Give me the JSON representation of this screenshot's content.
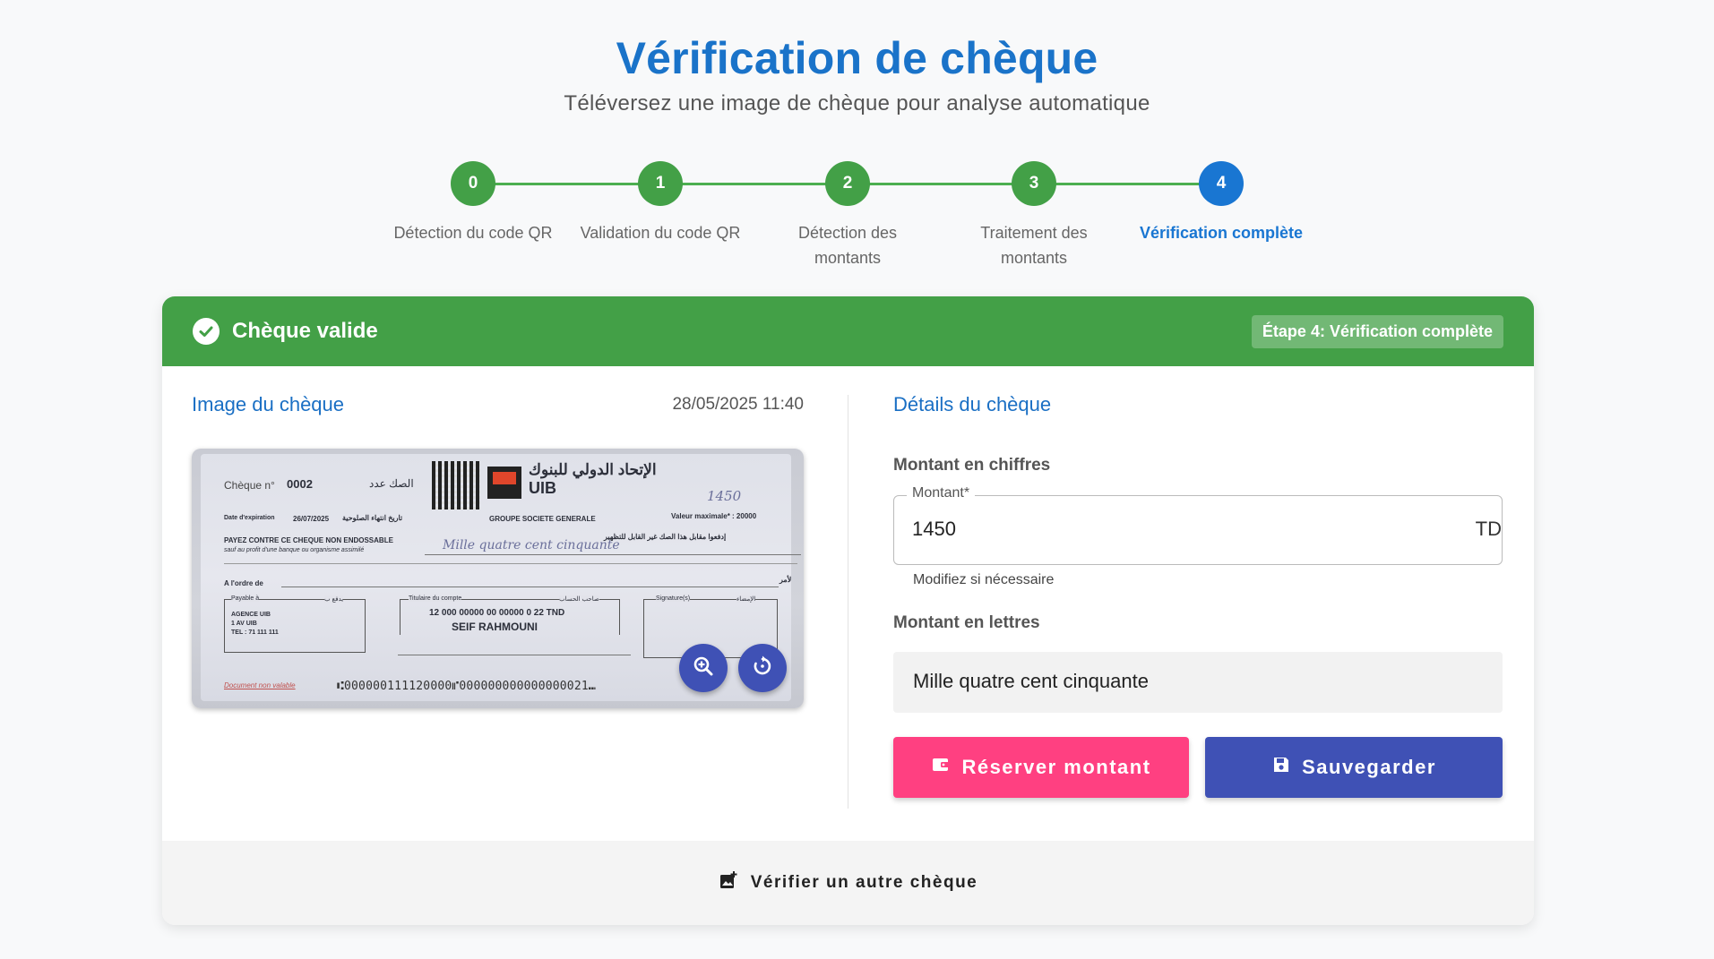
{
  "header": {
    "title": "Vérification de chèque",
    "subtitle": "Téléversez une image de chèque pour analyse automatique"
  },
  "stepper": {
    "steps": [
      {
        "number": "0",
        "label": "Détection du code QR",
        "status": "done"
      },
      {
        "number": "1",
        "label": "Validation du code QR",
        "status": "done"
      },
      {
        "number": "2",
        "label": "Détection des montants",
        "status": "done"
      },
      {
        "number": "3",
        "label": "Traitement des montants",
        "status": "done"
      },
      {
        "number": "4",
        "label": "Vérification complète",
        "status": "active"
      }
    ]
  },
  "result": {
    "status_title": "Chèque valide",
    "step_badge": "Étape 4: Vérification complète"
  },
  "image_section": {
    "title": "Image du chèque",
    "timestamp": "28/05/2025 11:40",
    "cheque": {
      "cheque_no_label": "Chèque n°",
      "cheque_no": "0002",
      "cheque_no_ar": "الصك عدد",
      "bank_ar": "الإتحاد الدولي للبنوك",
      "bank": "UIB",
      "group": "GROUPE SOCIETE GENERALE",
      "expiry_label": "Date d'expiration",
      "expiry": "26/07/2025",
      "expiry_ar": "تاريخ انتهاء الصلوحية",
      "max_value": "Valeur maximale* : 20000",
      "handwritten_amount": "1450",
      "pay_text": "PAYEZ CONTRE CE CHEQUE NON ENDOSSABLE",
      "pay_sub": "sauf au profit d'une banque ou organisme assimilé",
      "pay_ar": "إدفعوا مقابل هذا الصك غير القابل للتظهير",
      "handwritten_words": "Mille quatre cent cinquante",
      "order_label": "A l'ordre de",
      "order_ar": "لأمر",
      "payable_label": "Payable à",
      "payable_ar": "يدفع ب",
      "agency_lines": [
        "AGENCE UIB",
        "1 AV UIB",
        "TEL : 71 111 111"
      ],
      "holder_label": "Titulaire du compte",
      "holder_ar": "صاحب الحساب",
      "account": "12 000 00000 00 00000 0 22 TND",
      "holder_name": "SEIF RAHMOUNI",
      "signature_label": "Signature(s)",
      "signature_ar": "الإمضاء",
      "watermark": "Document non valable",
      "micr": "⑆000000111120000⑈000000000000000021⑉"
    },
    "zoom_icon": "zoom-in-icon",
    "rotate_icon": "rotate-icon"
  },
  "details": {
    "title": "Détails du chèque",
    "amount_digits_label": "Montant en chiffres",
    "amount_field_legend": "Montant*",
    "amount_value": "1450",
    "currency_suffix": "TD",
    "amount_helper": "Modifiez si nécessaire",
    "amount_words_label": "Montant en lettres",
    "amount_words_value": "Mille quatre cent cinquante",
    "reserve_button": "Réserver montant",
    "save_button": "Sauvegarder"
  },
  "footer": {
    "verify_another": "Vérifier un autre chèque"
  },
  "colors": {
    "primary": "#1a73c9",
    "success": "#43a047",
    "active_step": "#1976d2",
    "reserve": "#ff4081",
    "save": "#3f51b5"
  }
}
